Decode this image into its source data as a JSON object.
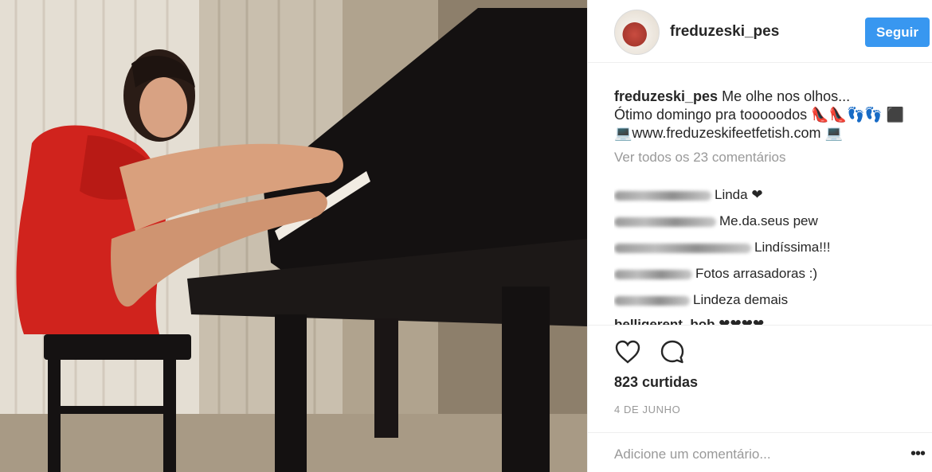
{
  "post": {
    "username": "freduzeski_pes",
    "follow_label": "Seguir",
    "caption_user": "freduzeski_pes",
    "caption_line1": "Me olhe nos olhos...",
    "caption_line2": "Ótimo domingo pra tooooodos 👠👠👣👣 ⬛",
    "caption_line3": "💻www.freduzeskifeetfetish.com 💻",
    "view_all": "Ver todos os 23 comentários",
    "comments": [
      {
        "text": "Linda ❤"
      },
      {
        "text": "Me.da.seus pew"
      },
      {
        "text": "Lindíssima!!!"
      },
      {
        "text": "Fotos arrasadoras :)"
      },
      {
        "text": "Lindeza demais"
      },
      {
        "text": "belligerent_bob ❤❤❤❤"
      }
    ],
    "likes": "823 curtidas",
    "date": "4 DE JUNHO",
    "add_comment_placeholder": "Adicione um comentário...",
    "more_label": "•••"
  },
  "colors": {
    "accent": "#3897f0",
    "muted": "#999999",
    "text": "#262626"
  },
  "icons": [
    "heart-icon",
    "comment-icon",
    "more-icon"
  ]
}
